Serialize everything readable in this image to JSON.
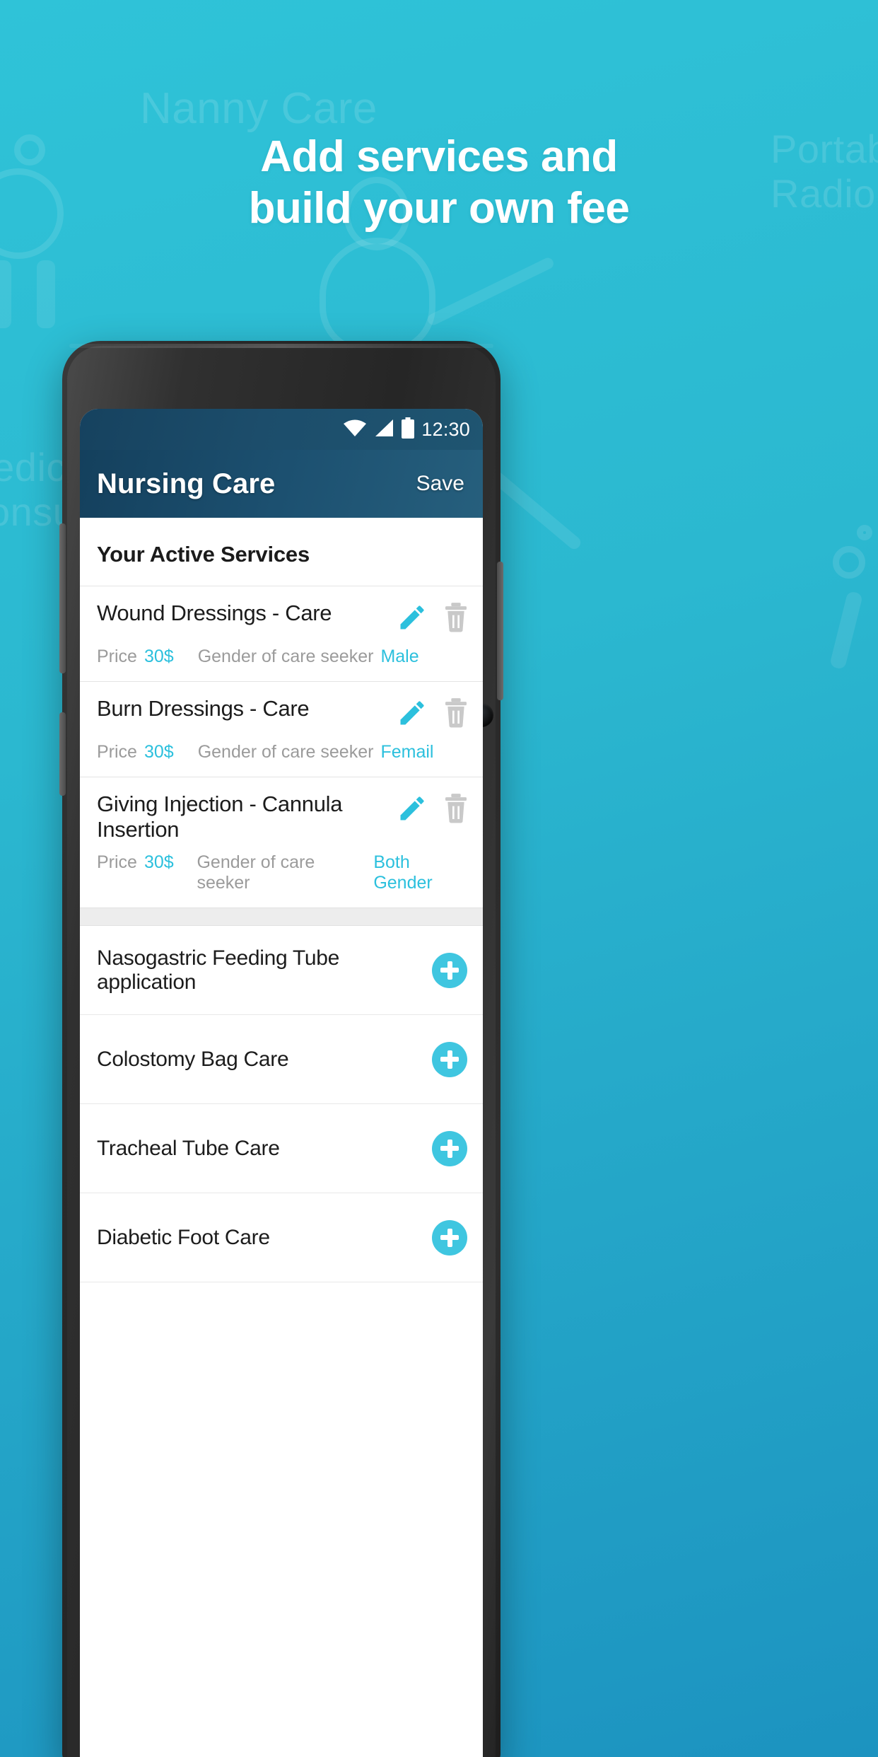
{
  "promo": {
    "headline_line1": "Add services and",
    "headline_line2": "build your own fee",
    "watermarks": {
      "nanny": "Nanny Care",
      "portable_line1": "Portable",
      "portable_line2": "Radiology",
      "medical_line1": "Medical",
      "medical_line2": "Consultation"
    },
    "colors": {
      "background_top": "#2fc3d8",
      "background_bottom": "#1c93c0",
      "headline_text": "#ffffff"
    }
  },
  "phone": {
    "status_bar": {
      "time": "12:30",
      "icons": [
        "wifi-icon",
        "signal-icon",
        "battery-icon"
      ]
    },
    "app_bar": {
      "title": "Nursing Care",
      "save_label": "Save",
      "background_color": "#1c5070"
    }
  },
  "screen": {
    "active_section": {
      "title": "Your Active Services",
      "price_label": "Price",
      "gender_label": "Gender of care seeker",
      "rows": [
        {
          "name": "Wound Dressings - Care",
          "price": "30$",
          "gender": "Male"
        },
        {
          "name": "Burn Dressings - Care",
          "price": "30$",
          "gender": "Femail"
        },
        {
          "name": "Giving Injection - Cannula Insertion",
          "price": "30$",
          "gender": "Both Gender"
        }
      ]
    },
    "available_section": {
      "rows": [
        {
          "name": "Nasogastric Feeding Tube application"
        },
        {
          "name": "Colostomy Bag Care"
        },
        {
          "name": "Tracheal Tube Care"
        },
        {
          "name": "Diabetic Foot Care"
        }
      ]
    },
    "colors": {
      "accent": "#2cc0dd",
      "add_button": "#3fc6e0",
      "muted_text": "#9b9b9b",
      "primary_text": "#1c1c1c"
    }
  }
}
